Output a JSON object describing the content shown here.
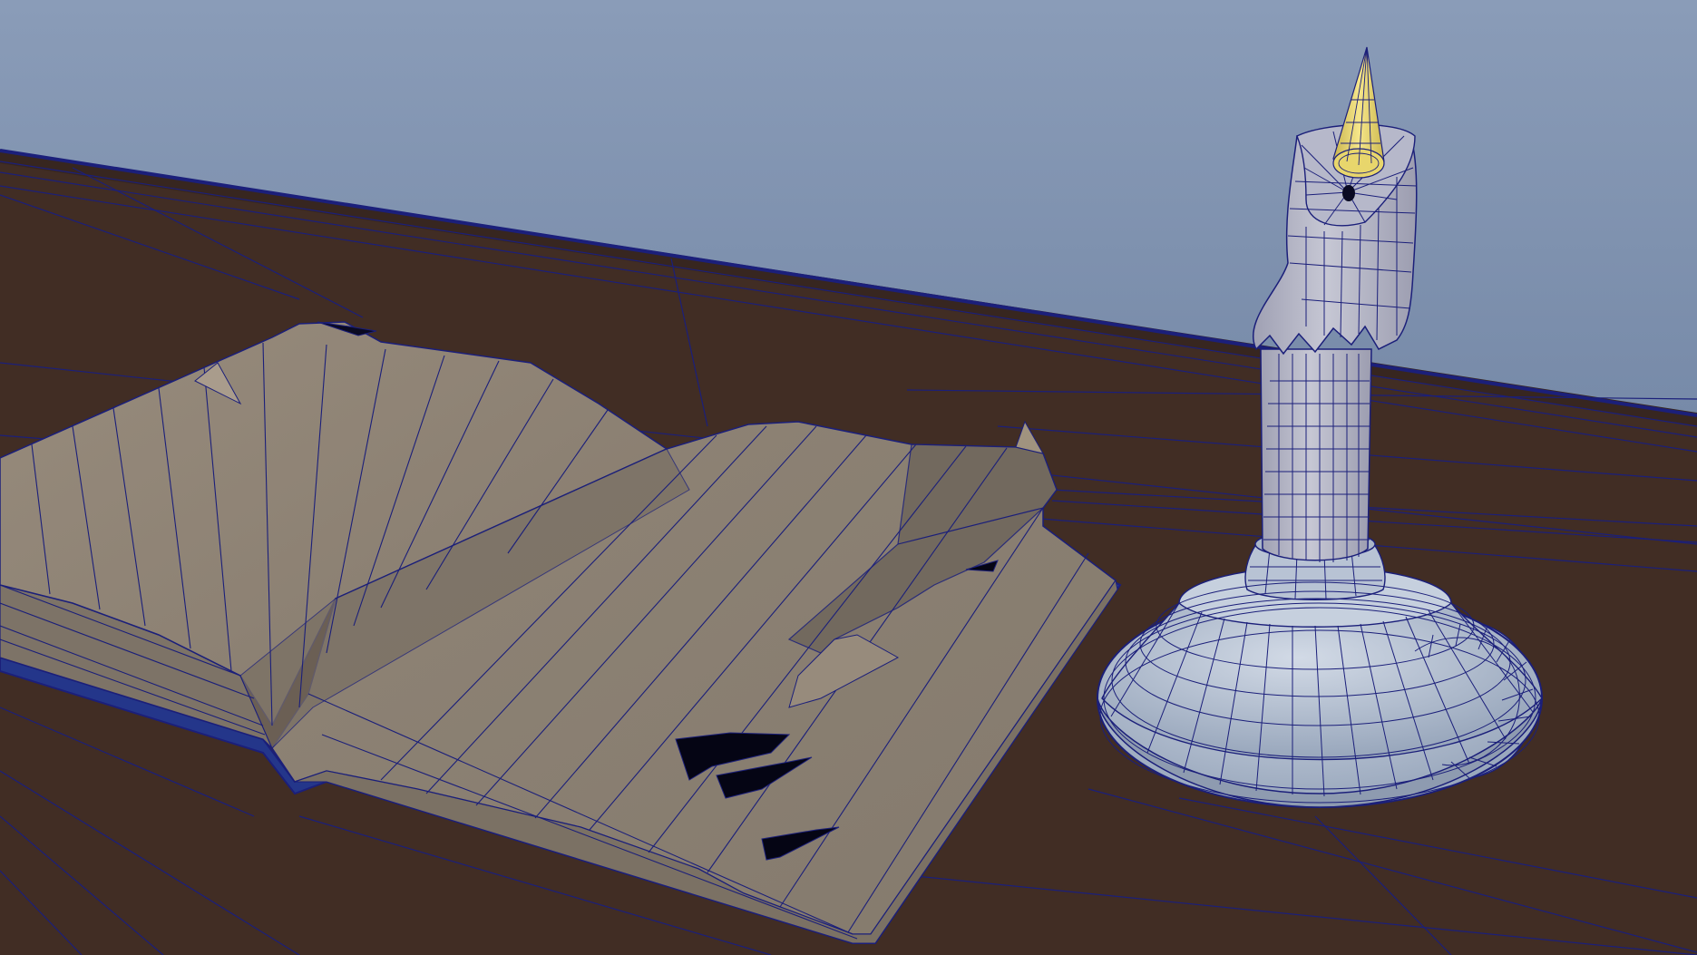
{
  "app": {
    "view": "3d-perspective-viewport",
    "display_mode": "wireframe-on-shaded"
  },
  "colors": {
    "background_top": "#8a9cb8",
    "background_bottom": "#5e7394",
    "table_surface": "#412d24",
    "table_edge": "#3a2820",
    "wire": "#1b1f7a",
    "book_page": "#8b8073",
    "book_page_light": "#a29686",
    "book_page_shadow": "#6f665b",
    "book_cover": "#24368a",
    "candle_wax": "#b4b6c8",
    "candle_holder": "#b7c3d4",
    "flame": "#f0df78",
    "hole": "#050514"
  },
  "scene": {
    "objects": [
      "table",
      "open-book",
      "candle",
      "candle-holder",
      "flame"
    ]
  }
}
